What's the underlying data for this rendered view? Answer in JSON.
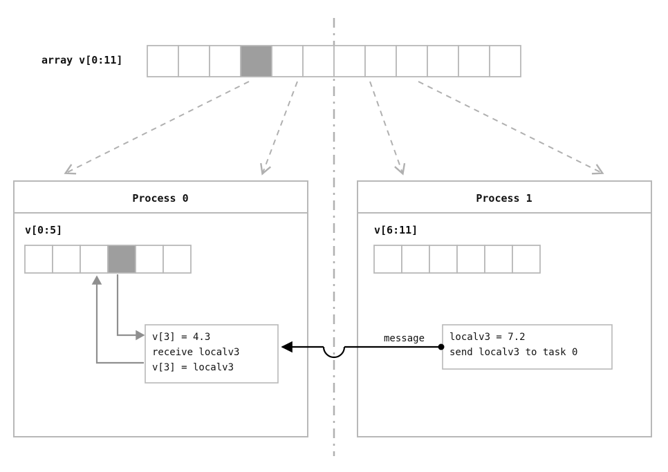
{
  "array": {
    "label": "array v[0:11]",
    "cell_count": 12,
    "shaded_index": 3
  },
  "process0": {
    "title": "Process 0",
    "subarray_label": "v[0:5]",
    "cell_count": 6,
    "shaded_index": 3,
    "code": {
      "line1": "v[3] = 4.3",
      "line2": "receive localv3",
      "line3": "v[3] = localv3"
    }
  },
  "process1": {
    "title": "Process 1",
    "subarray_label": "v[6:11]",
    "cell_count": 6,
    "shaded_index": null,
    "code": {
      "line1": "localv3 = 7.2",
      "line2": "send localv3 to task 0"
    }
  },
  "message_label": "message",
  "colors": {
    "cell_stroke": "#B8B8B8",
    "box_stroke": "#B8B8B8",
    "shaded_fill": "#9E9E9E",
    "dashed_gray": "#B0B0B0",
    "arrow_gray": "#8F8F8F",
    "black": "#000000",
    "text": "#111111"
  }
}
